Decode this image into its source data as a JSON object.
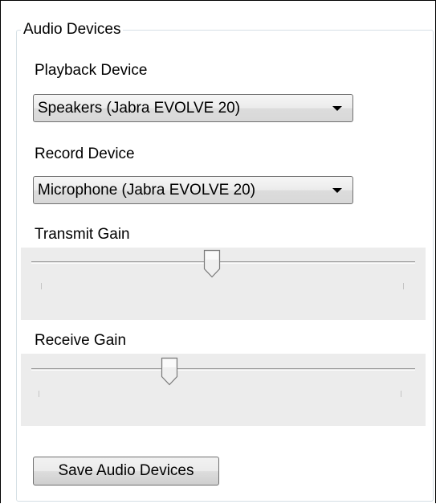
{
  "group": {
    "title": "Audio Devices"
  },
  "playback": {
    "label": "Playback Device",
    "selected": "Speakers (Jabra EVOLVE 20)"
  },
  "record": {
    "label": "Record Device",
    "selected": "Microphone (Jabra EVOLVE 20)"
  },
  "transmit_gain": {
    "label": "Transmit Gain",
    "level": 0.47
  },
  "receive_gain": {
    "label": "Receive Gain",
    "level": 0.36
  },
  "save_button": {
    "label": "Save Audio Devices"
  },
  "icons": {
    "combo_arrow": "chevron-down-icon"
  }
}
